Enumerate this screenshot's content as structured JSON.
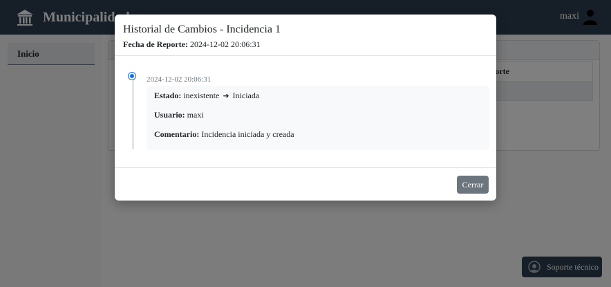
{
  "header": {
    "brand": "Municipalidad",
    "user": "maxi"
  },
  "sidebar": {
    "items": [
      {
        "label": "Inicio"
      }
    ]
  },
  "main": {
    "table": {
      "partial_header": "orte"
    }
  },
  "support": {
    "label": "Soporte técnico"
  },
  "modal": {
    "title": "Historial de Cambios - Incidencia 1",
    "report_label": "Fecha de Reporte:",
    "report_value": "2024-12-02 20:06:31",
    "entries": [
      {
        "date": "2024-12-02 20:06:31",
        "estado_label": "Estado:",
        "estado_from": "inexistente",
        "estado_arrow": "➜",
        "estado_to": "Iniciada",
        "usuario_label": "Usuario:",
        "usuario_value": "maxi",
        "comentario_label": "Comentario:",
        "comentario_value": "Incidencia iniciada y creada"
      }
    ],
    "close_label": "Cerrar"
  },
  "colors": {
    "primary": "#0d6efd",
    "topbar": "#2c3e50",
    "secondary": "#6c757d"
  },
  "icons": {
    "brand": "municipal-building-icon",
    "user": "user-icon",
    "support": "support-headset-icon"
  }
}
